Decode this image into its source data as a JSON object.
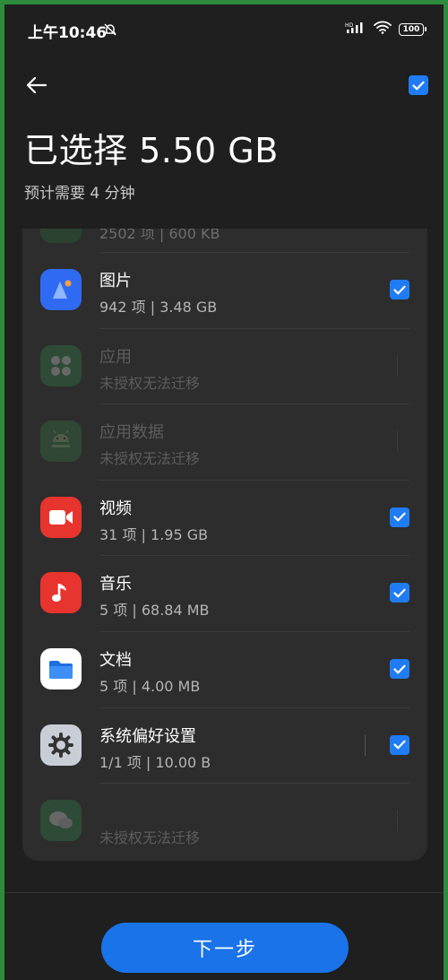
{
  "status_bar": {
    "time": "上午10:46",
    "network": "HD",
    "battery": "100"
  },
  "header": {
    "title": "已选择 5.50 GB",
    "subtitle": "预计需要 4 分钟"
  },
  "partial_row": {
    "meta": "2502 项 | 600 KB"
  },
  "items": [
    {
      "name": "图片",
      "meta": "942 项 | 3.48 GB",
      "icon": "photos-icon",
      "checked": true,
      "enabled": true,
      "color": "#2f6bf2"
    },
    {
      "name": "应用",
      "meta": "未授权无法迁移",
      "icon": "apps-icon",
      "checked": false,
      "enabled": false,
      "color": "#2e9b4d"
    },
    {
      "name": "应用数据",
      "meta": "未授权无法迁移",
      "icon": "android-icon",
      "checked": false,
      "enabled": false,
      "color": "#3a8a4a"
    },
    {
      "name": "视频",
      "meta": "31 项 | 1.95 GB",
      "icon": "video-icon",
      "checked": true,
      "enabled": true,
      "color": "#e8342e"
    },
    {
      "name": "音乐",
      "meta": "5 项 | 68.84 MB",
      "icon": "music-icon",
      "checked": true,
      "enabled": true,
      "color": "#e8342e"
    },
    {
      "name": "文档",
      "meta": "5 项 | 4.00 MB",
      "icon": "folder-icon",
      "checked": true,
      "enabled": true,
      "color": "#ffffff"
    },
    {
      "name": "系统偏好设置",
      "meta": "1/1 项 | 10.00 B",
      "icon": "settings-icon",
      "checked": true,
      "enabled": true,
      "color": "#9aa0a8"
    },
    {
      "name": "",
      "meta": "未授权无法迁移",
      "icon": "chat-icon",
      "checked": false,
      "enabled": false,
      "color": "#2e9b4d"
    }
  ],
  "footer": {
    "next_label": "下一步"
  },
  "colors": {
    "accent": "#1a73e8",
    "background": "#1f1f1f",
    "card": "#2d2d2d"
  }
}
